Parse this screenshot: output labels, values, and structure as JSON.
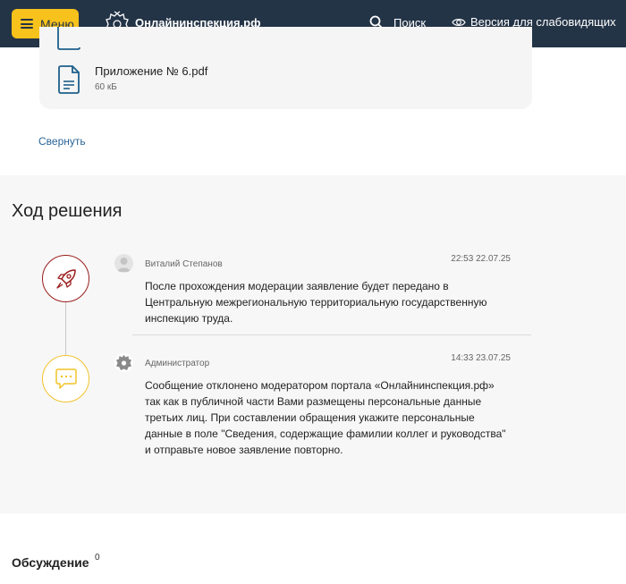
{
  "header": {
    "menu_label": "Меню",
    "site_name": "Онлайнинспекция.рф",
    "search_label": "Поиск",
    "accessibility_label": "Версия для слабовидящих",
    "background_color": "#243447",
    "accent_color": "#f8c21c"
  },
  "attachments": {
    "file": {
      "name": "Приложение № 6.pdf",
      "size": "60 кБ",
      "icon": "document-icon"
    },
    "collapse_label": "Свернуть"
  },
  "progress": {
    "title": "Ход решения",
    "entries": [
      {
        "icon": "rocket-icon",
        "author": "Виталий Степанов",
        "time": "22:53 22.07.25",
        "message": "После прохождения модерации заявление будет передано в Центральную межрегиональную территориальную государственную инспекцию труда."
      },
      {
        "icon": "chat-icon",
        "author": "Администратор",
        "time": "14:33 23.07.25",
        "message": "Сообщение отклонено модератором портала «Онлайнинспекция.рф» так как в публичной части Вами размещены персональные данные третьих лиц. При составлении обращения укажите персональные данные в поле \"Сведения, содержащие фамилии коллег и руководства\" и отправьте новое заявление повторно."
      }
    ]
  },
  "discussion": {
    "title": "Обсуждение",
    "count": "0"
  }
}
